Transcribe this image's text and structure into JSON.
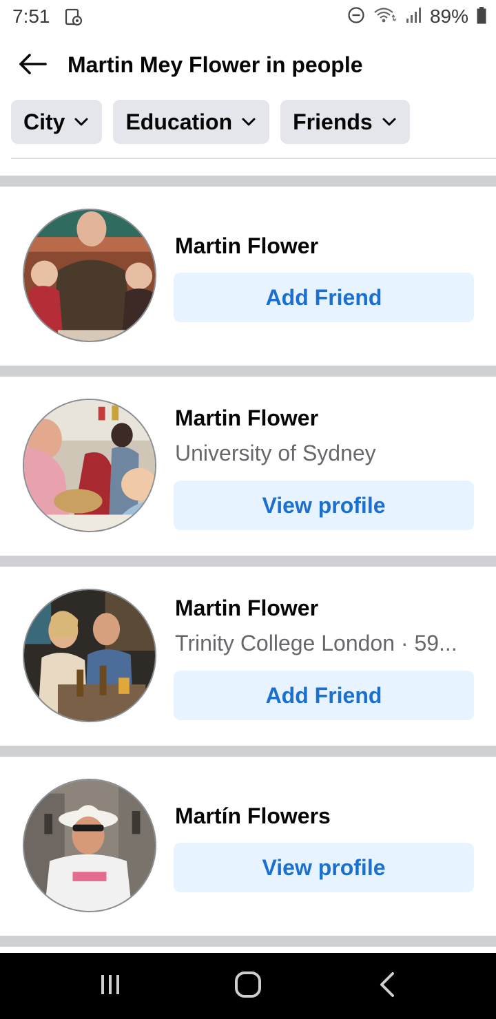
{
  "status_bar": {
    "time": "7:51",
    "battery": "89%",
    "icons": [
      "screenshot-icon",
      "dnd-icon",
      "wifi-icon",
      "signal-icon",
      "battery-icon"
    ]
  },
  "header": {
    "title": "Martin Mey Flower in people",
    "back_icon": "arrow-left-icon"
  },
  "filters": [
    {
      "label": "City",
      "icon": "chevron-down-icon"
    },
    {
      "label": "Education",
      "icon": "chevron-down-icon"
    },
    {
      "label": "Friends",
      "icon": "chevron-down-icon"
    }
  ],
  "results": [
    {
      "name": "Martin Flower",
      "subtitle": "",
      "action": "Add Friend"
    },
    {
      "name": "Martin Flower",
      "subtitle": "University of Sydney",
      "action": "View profile"
    },
    {
      "name": "Martin Flower",
      "subtitle": "Trinity College London · 59...",
      "action": "Add Friend"
    },
    {
      "name": "Martín Flowers",
      "subtitle": "",
      "action": "View profile"
    }
  ],
  "nav_bar": {
    "icons": [
      "recents-icon",
      "home-icon",
      "back-icon"
    ]
  },
  "colors": {
    "accent": "#1b6fcf",
    "button_bg": "#e7f3ff",
    "chip_bg": "#e4e6eb",
    "separator": "#ced0d4"
  }
}
